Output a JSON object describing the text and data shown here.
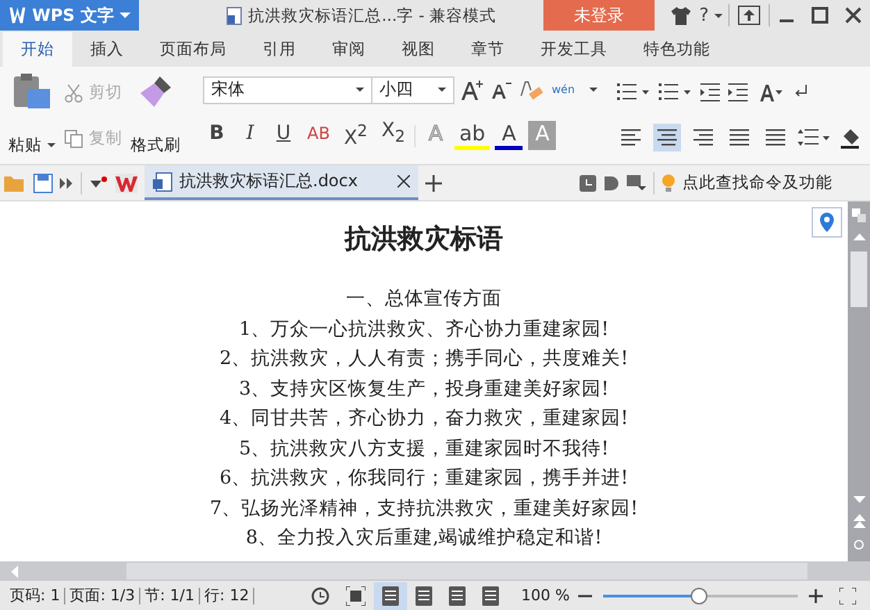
{
  "title_bar": {
    "app_name": "WPS 文字",
    "doc_title": "抗洪救灾标语汇总...字 - 兼容模式",
    "login": "未登录",
    "help": "?"
  },
  "tabs": [
    {
      "label": "开始",
      "selected": true
    },
    {
      "label": "插入",
      "selected": false
    },
    {
      "label": "页面布局",
      "selected": false
    },
    {
      "label": "引用",
      "selected": false
    },
    {
      "label": "审阅",
      "selected": false
    },
    {
      "label": "视图",
      "selected": false
    },
    {
      "label": "章节",
      "selected": false
    },
    {
      "label": "开发工具",
      "selected": false
    },
    {
      "label": "特色功能",
      "selected": false
    }
  ],
  "ribbon": {
    "paste": "粘贴",
    "cut": {
      "label": "剪切",
      "disabled": true
    },
    "copy": {
      "label": "复制",
      "disabled": true
    },
    "format_painter": "格式刷",
    "font_name": "宋体",
    "font_size": "小四",
    "phonetic": "wén",
    "format_buttons": [
      {
        "kind": "bold",
        "text": "B"
      },
      {
        "kind": "italic",
        "text": "I"
      },
      {
        "kind": "underline",
        "text": "U"
      },
      {
        "kind": "strike",
        "text": "AB"
      },
      {
        "kind": "plain",
        "text": "X$^{2}$"
      },
      {
        "kind": "plain",
        "text": "X$_{2}$"
      }
    ],
    "font_color_buttons": [
      {
        "kind": "outline",
        "text": "A",
        "color": "#c8c8c8"
      },
      {
        "kind": "highlight",
        "text": "ab",
        "color": "#ffff00"
      },
      {
        "kind": "fontcolor",
        "text": "A",
        "color": "#0000c0"
      },
      {
        "kind": "shade",
        "text": "A",
        "color": "#a0a0a0"
      }
    ],
    "align_buttons": [
      {
        "selected": false
      },
      {
        "selected": true
      },
      {
        "selected": false
      },
      {
        "selected": false
      },
      {
        "selected": false
      }
    ]
  },
  "doc_tabs": [
    {
      "label": "抗洪救灾标语汇总.docx",
      "selected": true
    }
  ],
  "search": "点此查找命令及功能",
  "document": {
    "title": "抗洪救灾标语",
    "lines": [
      "一、总体宣传方面",
      "1、万众一心抗洪救灾、齐心协力重建家园!",
      "2、抗洪救灾，人人有责；携手同心，共度难关!",
      "3、支持灾区恢复生产，投身重建美好家园!",
      "4、同甘共苦，齐心协力，奋力救灾，重建家园!",
      "5、抗洪救灾八方支援，重建家园时不我待!",
      "6、抗洪救灾，你我同行；重建家园，携手并进!",
      "7、弘扬光泽精神，支持抗洪救灾，重建美好家园!",
      "8、全力投入灾后重建,竭诚维护稳定和谐!"
    ]
  },
  "status_bar": {
    "items": [
      "页码: 1",
      "页面: 1/3",
      "节: 1/1",
      "行: 12"
    ],
    "views": [
      {
        "selected": true
      },
      {
        "selected": false
      },
      {
        "selected": false
      },
      {
        "selected": false
      }
    ],
    "zoom": "100 %",
    "zoom_level": {
      "level": 0.49
    }
  }
}
